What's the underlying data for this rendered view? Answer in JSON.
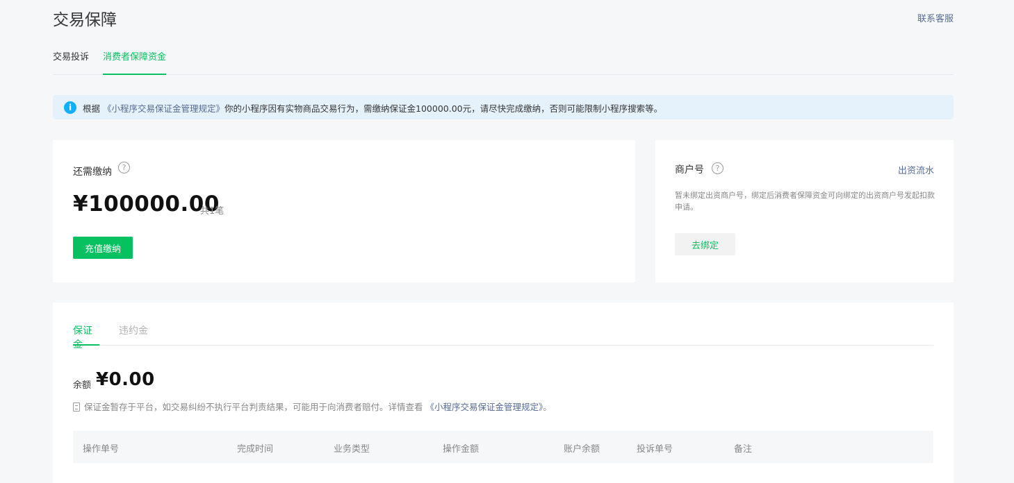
{
  "header": {
    "title": "交易保障",
    "contact_link": "联系客服"
  },
  "top_tabs": [
    {
      "label": "交易投诉",
      "active": false
    },
    {
      "label": "消费者保障资金",
      "active": true
    }
  ],
  "notice": {
    "icon": "info-icon",
    "prefix": "根据",
    "link_text": "《小程序交易保证金管理规定》",
    "suffix": "你的小程序因有实物商品交易行为，需缴纳保证金100000.00元，请尽快完成缴纳，否则可能限制小程序搜索等。"
  },
  "due_card": {
    "label": "还需缴纳",
    "amount": "¥100000.00",
    "count": "共1笔",
    "button": "充值缴纳"
  },
  "merchant_card": {
    "title": "商户号",
    "fund_link": "出资流水",
    "description": "暂未绑定出资商户号，绑定后消费者保障资金可向绑定的出资商户号发起扣款申请。",
    "button": "去绑定"
  },
  "fund_tabs": [
    {
      "label": "保证金",
      "active": true
    },
    {
      "label": "违约金",
      "active": false
    }
  ],
  "balance": {
    "label": "余额",
    "amount": "¥0.00",
    "note_prefix": "保证金暂存于平台，如交易纠纷不执行平台判责结果，可能用于向消费者赔付。详情查看",
    "note_link": "《小程序交易保证金管理规定》",
    "note_suffix": "。"
  },
  "table": {
    "columns": [
      "操作单号",
      "完成时间",
      "业务类型",
      "操作金额",
      "账户余额",
      "投诉单号",
      "备注"
    ]
  },
  "colors": {
    "accent": "#07c160",
    "link": "#576b95",
    "info": "#10aeff",
    "notice_bg": "#e6f2fb"
  }
}
